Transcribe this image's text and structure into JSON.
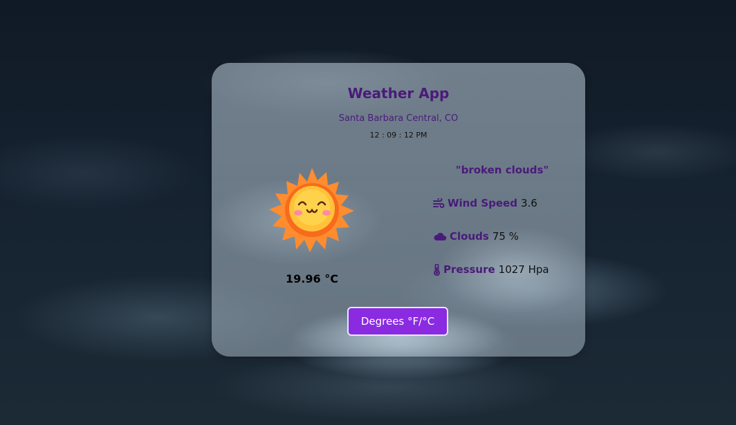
{
  "app": {
    "title": "Weather App"
  },
  "location": {
    "name": "Santa Barbara Central, CO",
    "time": "12 : 09 : 12 PM"
  },
  "current": {
    "icon": "smiling-sun-icon",
    "temperature": "19.96 °C",
    "description": "\"broken clouds\""
  },
  "stats": {
    "wind": {
      "icon": "wind-icon",
      "label": "Wind Speed",
      "value": "3.6"
    },
    "clouds": {
      "icon": "cloud-icon",
      "label": "Clouds",
      "value": "75 %"
    },
    "pressure": {
      "icon": "thermometer-icon",
      "label": "Pressure",
      "value": "1027 Hpa"
    }
  },
  "controls": {
    "unit_toggle_label": "Degrees °F/°C"
  },
  "colors": {
    "accent": "#4a1a7a",
    "button": "#8a2be2",
    "sun": "#ff9a30"
  }
}
